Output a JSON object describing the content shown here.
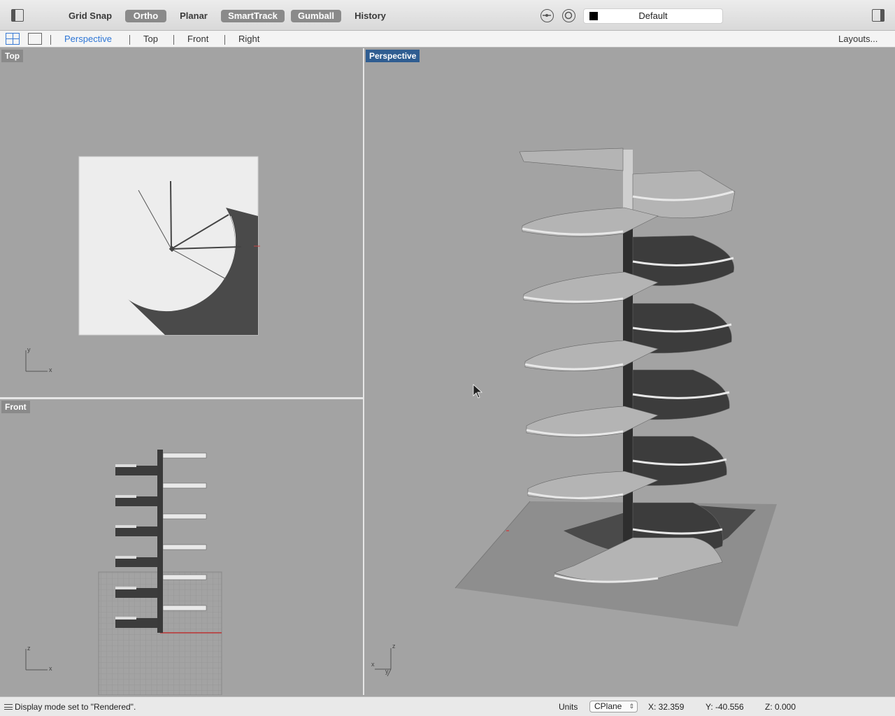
{
  "toolbar": {
    "grid_snap": "Grid Snap",
    "ortho": "Ortho",
    "planar": "Planar",
    "smarttrack": "SmartTrack",
    "gumball": "Gumball",
    "history": "History",
    "layer_name": "Default",
    "layer_color": "#000000"
  },
  "tabs": {
    "perspective": "Perspective",
    "top": "Top",
    "front": "Front",
    "right": "Right",
    "layouts": "Layouts..."
  },
  "viewports": {
    "top_label": "Top",
    "front_label": "Front",
    "perspective_label": "Perspective",
    "axis_x": "x",
    "axis_y": "y",
    "axis_z": "z"
  },
  "status": {
    "message": "Display mode set to \"Rendered\".",
    "units": "Units",
    "cplane": "CPlane",
    "x": "X: 32.359",
    "y": "Y: -40.556",
    "z": "Z: 0.000"
  },
  "colors": {
    "active_tab": "#2e76d6",
    "active_viewport": "#2f5d91",
    "viewport_bg": "#a3a3a3"
  }
}
